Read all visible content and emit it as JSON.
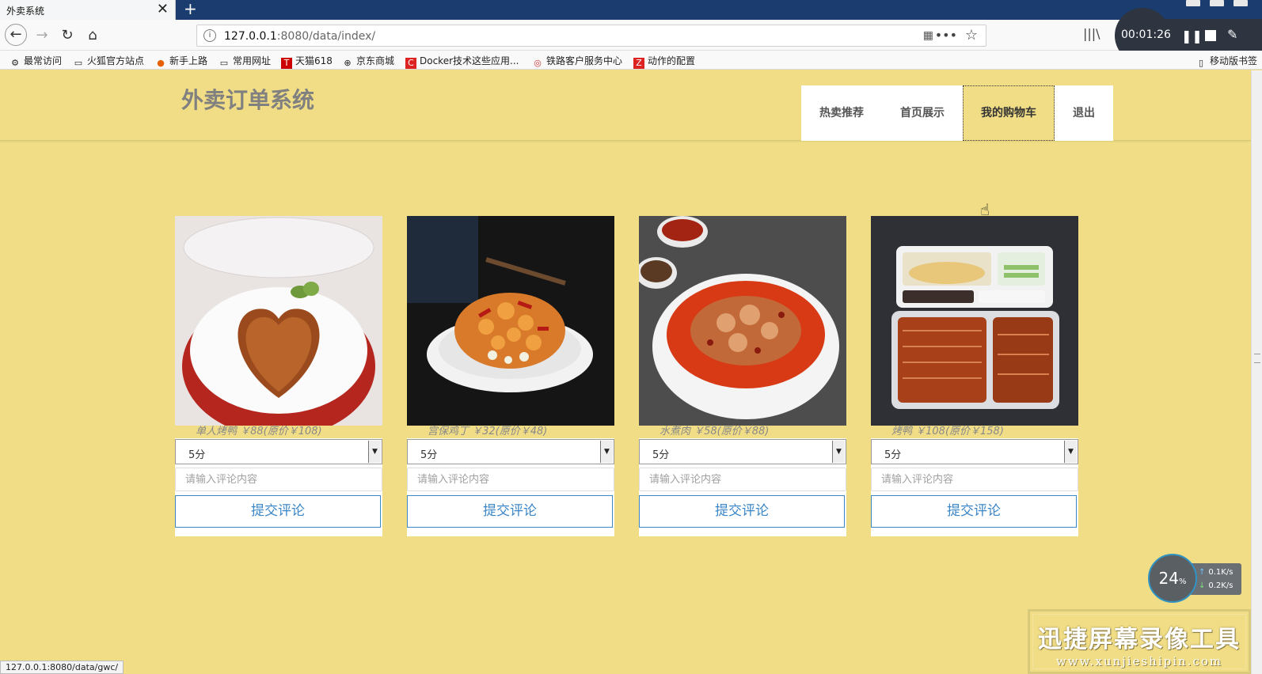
{
  "browser": {
    "tab_title": "外卖系统",
    "tab_close": "✕",
    "new_tab": "+",
    "url_host": "127.0.0.1",
    "url_rest": ":8080/data/index/",
    "status_url": "127.0.0.1:8080/data/gwc/"
  },
  "recorder": {
    "time": "00:01:26"
  },
  "bookmarks": [
    {
      "label": "最常访问",
      "icon": "gear-icon"
    },
    {
      "label": "火狐官方站点",
      "icon": "folder-icon"
    },
    {
      "label": "新手上路",
      "icon": "firefox-icon"
    },
    {
      "label": "常用网址",
      "icon": "folder-icon"
    },
    {
      "label": "天猫618",
      "icon": "tmall-icon"
    },
    {
      "label": "京东商城",
      "icon": "globe-icon"
    },
    {
      "label": "Docker技术这些应用...",
      "icon": "c-icon"
    },
    {
      "label": "铁路客户服务中心",
      "icon": "rail-icon"
    },
    {
      "label": "动作的配置",
      "icon": "z-icon"
    }
  ],
  "mobile_bookmarks": "移动版书签",
  "site": {
    "title": "外卖订单系统",
    "menu": [
      "热卖推荐",
      "首页展示",
      "我的购物车",
      "退出"
    ],
    "active_menu_index": 2
  },
  "products": [
    {
      "caption": "单人烤鸭 ￥88(原价￥108)",
      "rating": "5分",
      "comment_placeholder": "请输入评论内容",
      "submit_label": "提交评论"
    },
    {
      "caption": "宫保鸡丁 ￥32(原价￥48)",
      "rating": "5分",
      "comment_placeholder": "请输入评论内容",
      "submit_label": "提交评论"
    },
    {
      "caption": "水煮肉 ￥58(原价￥88)",
      "rating": "5分",
      "comment_placeholder": "请输入评论内容",
      "submit_label": "提交评论"
    },
    {
      "caption": "烤鸭 ￥108(原价￥158)",
      "rating": "5分",
      "comment_placeholder": "请输入评论内容",
      "submit_label": "提交评论"
    }
  ],
  "net_widget": {
    "percent": "24",
    "percent_unit": "%",
    "up": "0.1",
    "down": "0.2",
    "unit": "K/s"
  },
  "watermark": {
    "title": "迅捷屏幕录像工具",
    "url": "www.xunjieshipin.com"
  },
  "colors": {
    "page_bg": "#f0dd85",
    "button_blue": "#3b86c7",
    "title_gray": "#808080"
  }
}
